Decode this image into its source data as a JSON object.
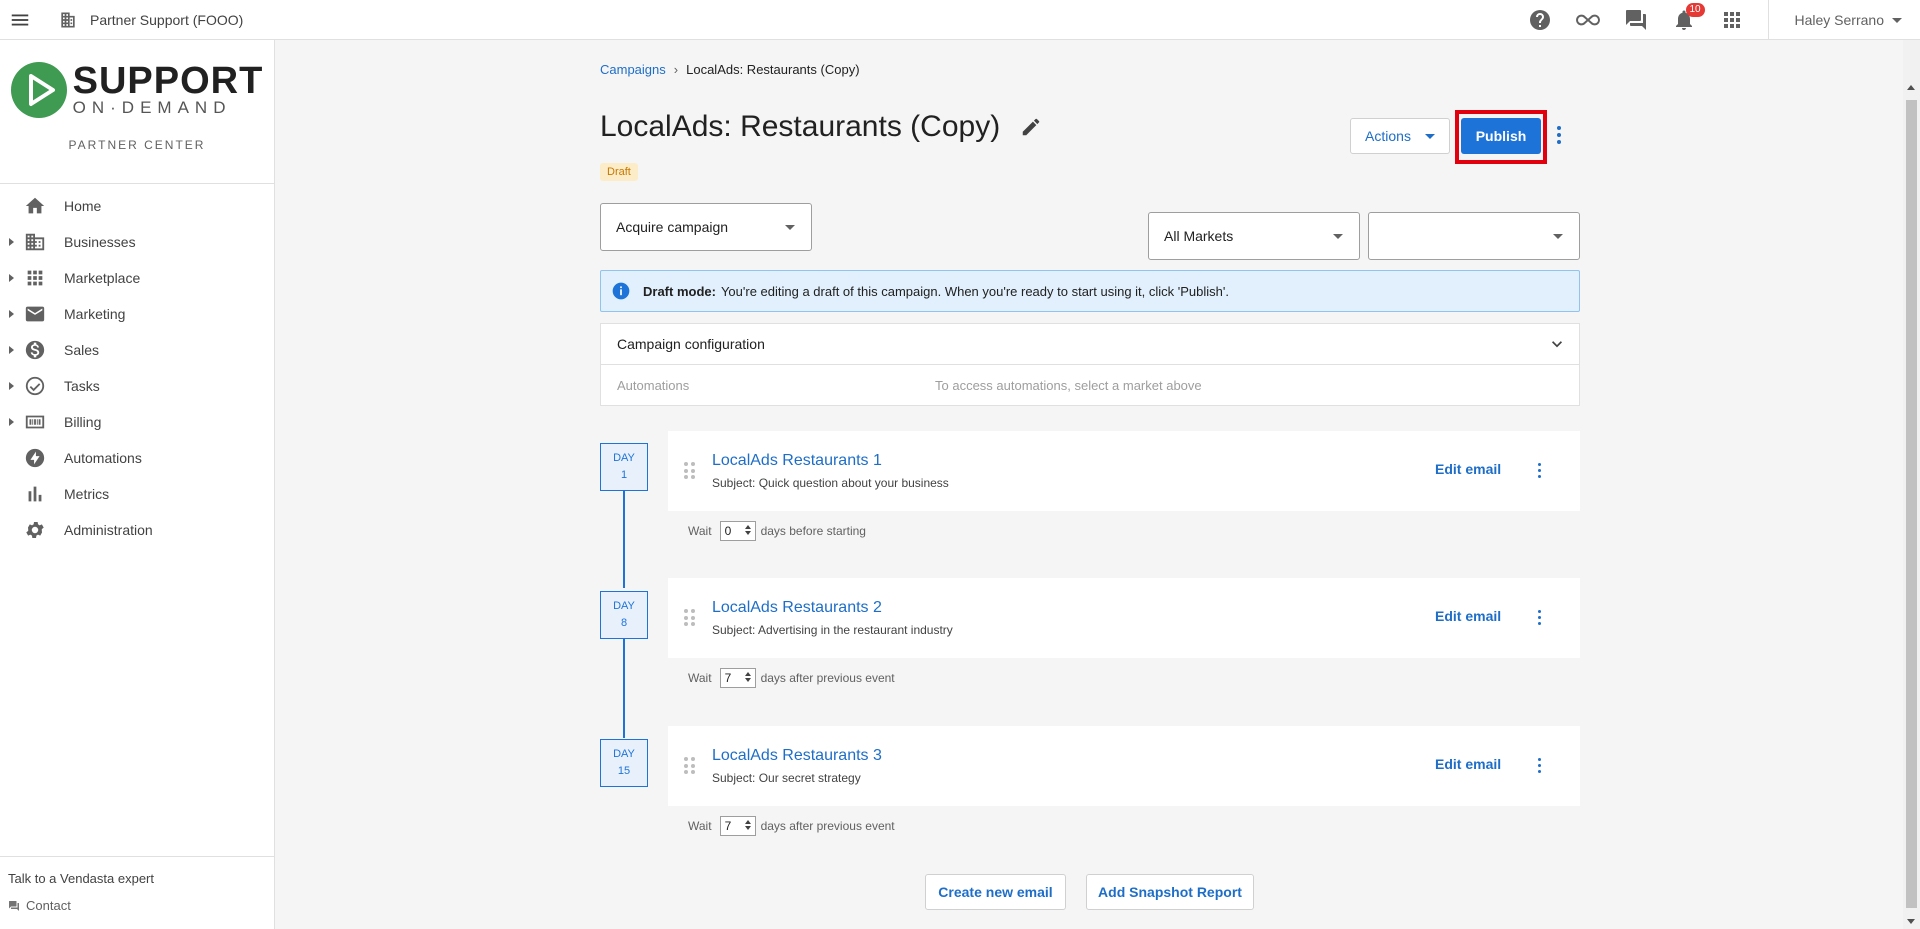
{
  "topbar": {
    "org_name": "Partner Support (FOOO)",
    "notification_count": "10",
    "user_name": "Haley Serrano",
    "icons": [
      "menu-icon",
      "building-icon",
      "help-icon",
      "infinity-icon",
      "chat-icon",
      "bell-icon",
      "apps-icon"
    ]
  },
  "sidebar": {
    "logo": {
      "line1": "SUPPORT",
      "line2": "ON·DEMAND",
      "subtitle": "PARTNER CENTER",
      "brand_color": "#3f9a52"
    },
    "items": [
      {
        "label": "Home",
        "icon": "home-icon",
        "expandable": false
      },
      {
        "label": "Businesses",
        "icon": "building-icon",
        "expandable": true
      },
      {
        "label": "Marketplace",
        "icon": "grid-icon",
        "expandable": true
      },
      {
        "label": "Marketing",
        "icon": "mail-icon",
        "expandable": true
      },
      {
        "label": "Sales",
        "icon": "dollar-icon",
        "expandable": true
      },
      {
        "label": "Tasks",
        "icon": "check-circle-icon",
        "expandable": true
      },
      {
        "label": "Billing",
        "icon": "billing-icon",
        "expandable": true
      },
      {
        "label": "Automations",
        "icon": "bolt-icon",
        "expandable": false
      },
      {
        "label": "Metrics",
        "icon": "bar-chart-icon",
        "expandable": false
      },
      {
        "label": "Administration",
        "icon": "gear-icon",
        "expandable": false
      }
    ],
    "footer": {
      "talk": "Talk to a Vendasta expert",
      "contact": "Contact"
    }
  },
  "main": {
    "breadcrumb": {
      "parent": "Campaigns",
      "separator": "›",
      "current": "LocalAds: Restaurants (Copy)"
    },
    "title": "LocalAds: Restaurants (Copy)",
    "status": "Draft",
    "actions_label": "Actions",
    "publish_label": "Publish",
    "campaign_type": "Acquire campaign",
    "market_select": "All Markets",
    "second_select": "",
    "banner": {
      "bold": "Draft mode:",
      "text": "You're editing a draft of this campaign. When you're ready to start using it, click 'Publish'."
    },
    "config": {
      "title": "Campaign configuration",
      "automations_label": "Automations",
      "automations_msg": "To access automations, select a market above"
    },
    "steps": [
      {
        "day_label": "DAY",
        "day": "1",
        "title": "LocalAds Restaurants 1",
        "subject": "Subject: Quick question about your business",
        "edit": "Edit email",
        "wait_label": "Wait",
        "wait_value": "0",
        "wait_suffix": "days before starting"
      },
      {
        "day_label": "DAY",
        "day": "8",
        "title": "LocalAds Restaurants 2",
        "subject": "Subject: Advertising in the restaurant industry",
        "edit": "Edit email",
        "wait_label": "Wait",
        "wait_value": "7",
        "wait_suffix": "days after previous event"
      },
      {
        "day_label": "DAY",
        "day": "15",
        "title": "LocalAds Restaurants 3",
        "subject": "Subject: Our secret strategy",
        "edit": "Edit email",
        "wait_label": "Wait",
        "wait_value": "7",
        "wait_suffix": "days after previous event"
      }
    ],
    "create_email_label": "Create new email",
    "add_snapshot_label": "Add Snapshot Report",
    "colors": {
      "accent": "#1e73d8",
      "highlight": "#e0000e",
      "draft": "#c77700"
    }
  }
}
